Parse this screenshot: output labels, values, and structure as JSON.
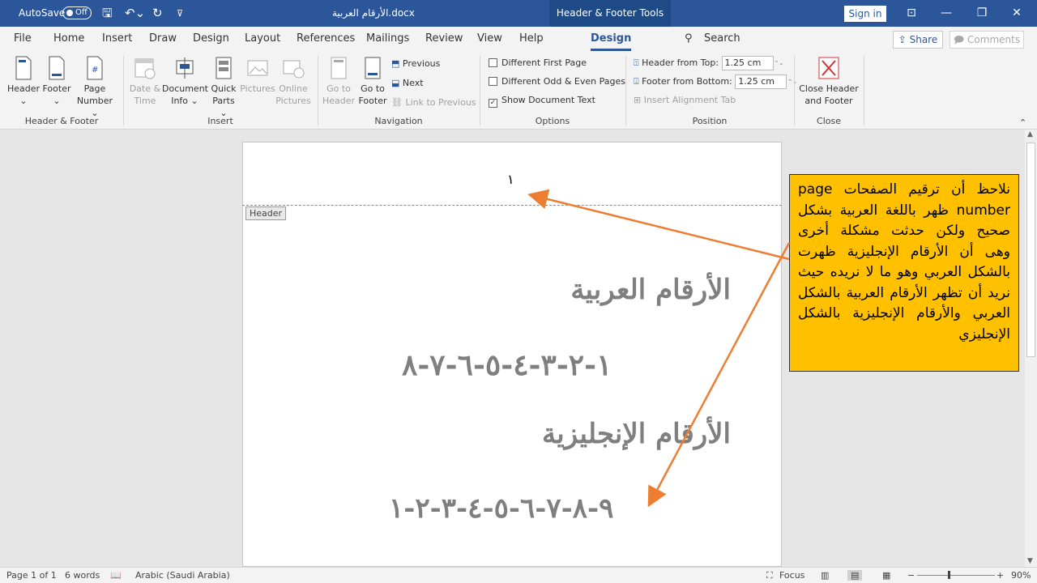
{
  "titlebar": {
    "autosave_label": "AutoSave",
    "autosave_state": "Off",
    "doc_title": "الأرقام العربية.docx",
    "context_tab": "Header & Footer Tools",
    "signin": "Sign in"
  },
  "menu": {
    "items": [
      "File",
      "Home",
      "Insert",
      "Draw",
      "Design",
      "Layout",
      "References",
      "Mailings",
      "Review",
      "View",
      "Help",
      "Design"
    ],
    "search": "Search",
    "share": "Share",
    "comments": "Comments"
  },
  "ribbon": {
    "header_footer": {
      "header": "Header",
      "footer": "Footer",
      "page_number": "Page",
      "page_number2": "Number",
      "group": "Header & Footer"
    },
    "insert": {
      "date1": "Date &",
      "date2": "Time",
      "docinfo1": "Document",
      "docinfo2": "Info",
      "quick1": "Quick",
      "quick2": "Parts",
      "pictures": "Pictures",
      "online1": "Online",
      "online2": "Pictures",
      "group": "Insert"
    },
    "navigation": {
      "gotoh1": "Go to",
      "gotoh2": "Header",
      "gotof1": "Go to",
      "gotof2": "Footer",
      "previous": "Previous",
      "next": "Next",
      "link": "Link to Previous",
      "group": "Navigation"
    },
    "options": {
      "first_page": "Different First Page",
      "odd_even": "Different Odd & Even Pages",
      "show_text": "Show Document Text",
      "group": "Options"
    },
    "position": {
      "header_top_label": "Header from Top:",
      "header_top_value": "1.25 cm",
      "footer_bottom_label": "Footer from Bottom:",
      "footer_bottom_value": "1.25 cm",
      "align_tab": "Insert Alignment Tab",
      "group": "Position"
    },
    "close": {
      "close1": "Close Header",
      "close2": "and Footer",
      "group": "Close"
    }
  },
  "document": {
    "header_page_number": "١",
    "header_tag": "Header",
    "heading_arabic": "الأرقام العربية",
    "numbers_arabic": "١-٢-٣-٤-٥-٦-٧-٨",
    "heading_english": "الأرقام الإنجليزية",
    "numbers_english": "٩-٨-٧-٦-٥-٤-٣-٢-١"
  },
  "callout": {
    "text": "نلاحظ أن ترقيم الصفحات page number ظهر باللغة العربية بشكل صحيح ولكن حدثت مشكلة أخرى وهى أن الأرقام الإنجليزية ظهرت بالشكل العربي وهو ما لا نريده حيث نريد أن تظهر الأرقام العربية بالشكل العربي والأرقام الإنجليزية بالشكل الإنجليزي"
  },
  "status": {
    "page": "Page 1 of 1",
    "words": "6 words",
    "language": "Arabic (Saudi Arabia)",
    "focus": "Focus",
    "zoom": "90%"
  },
  "colors": {
    "brand": "#2b579a",
    "callout_bg": "#ffc000",
    "arrow": "#ed7d31"
  }
}
